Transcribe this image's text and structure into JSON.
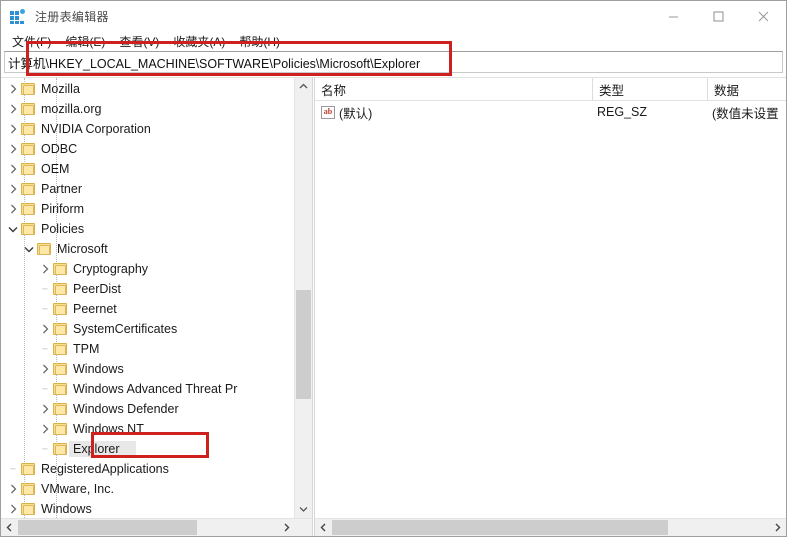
{
  "window": {
    "title": "注册表编辑器",
    "icon": "registry-editor-icon",
    "controls": {
      "minimize": "minimize-icon",
      "maximize": "maximize-icon",
      "close": "close-icon"
    }
  },
  "menubar": {
    "items": [
      {
        "label": "文件(F)",
        "name": "menu-file"
      },
      {
        "label": "编辑(E)",
        "name": "menu-edit"
      },
      {
        "label": "查看(V)",
        "name": "menu-view"
      },
      {
        "label": "收藏夹(A)",
        "name": "menu-favorites"
      },
      {
        "label": "帮助(H)",
        "name": "menu-help"
      }
    ]
  },
  "address_bar": {
    "value": "计算机\\HKEY_LOCAL_MACHINE\\SOFTWARE\\Policies\\Microsoft\\Explorer",
    "placeholder": ""
  },
  "tree": {
    "nodes": [
      {
        "label": "Mozilla",
        "depth": 2,
        "twist": "collapsed",
        "selected": false
      },
      {
        "label": "mozilla.org",
        "depth": 2,
        "twist": "collapsed",
        "selected": false
      },
      {
        "label": "NVIDIA Corporation",
        "depth": 2,
        "twist": "collapsed",
        "selected": false
      },
      {
        "label": "ODBC",
        "depth": 2,
        "twist": "collapsed",
        "selected": false
      },
      {
        "label": "OEM",
        "depth": 2,
        "twist": "collapsed",
        "selected": false
      },
      {
        "label": "Partner",
        "depth": 2,
        "twist": "collapsed",
        "selected": false
      },
      {
        "label": "Piriform",
        "depth": 2,
        "twist": "collapsed",
        "selected": false
      },
      {
        "label": "Policies",
        "depth": 2,
        "twist": "expanded",
        "selected": false
      },
      {
        "label": "Microsoft",
        "depth": 3,
        "twist": "expanded",
        "selected": false
      },
      {
        "label": "Cryptography",
        "depth": 4,
        "twist": "collapsed",
        "selected": false
      },
      {
        "label": "PeerDist",
        "depth": 4,
        "twist": "leaf",
        "selected": false
      },
      {
        "label": "Peernet",
        "depth": 4,
        "twist": "leaf",
        "selected": false
      },
      {
        "label": "SystemCertificates",
        "depth": 4,
        "twist": "collapsed",
        "selected": false
      },
      {
        "label": "TPM",
        "depth": 4,
        "twist": "leaf",
        "selected": false
      },
      {
        "label": "Windows",
        "depth": 4,
        "twist": "collapsed",
        "selected": false
      },
      {
        "label": "Windows Advanced Threat Pr",
        "depth": 4,
        "twist": "leaf",
        "selected": false
      },
      {
        "label": "Windows Defender",
        "depth": 4,
        "twist": "collapsed",
        "selected": false
      },
      {
        "label": "Windows NT",
        "depth": 4,
        "twist": "collapsed",
        "selected": false
      },
      {
        "label": "Explorer",
        "depth": 4,
        "twist": "leaf",
        "selected": true
      },
      {
        "label": "RegisteredApplications",
        "depth": 2,
        "twist": "leaf",
        "selected": false
      },
      {
        "label": "VMware, Inc.",
        "depth": 2,
        "twist": "collapsed",
        "selected": false
      },
      {
        "label": "Windows",
        "depth": 2,
        "twist": "collapsed",
        "selected": false
      }
    ],
    "scroll": {
      "vertical_thumb_top_pct": 48,
      "vertical_thumb_height_pct": 27,
      "horizontal_thumb_left_pct": 0,
      "horizontal_thumb_width_pct": 69
    }
  },
  "value_list": {
    "columns": [
      {
        "label": "名称",
        "name": "column-name"
      },
      {
        "label": "类型",
        "name": "column-type"
      },
      {
        "label": "数据",
        "name": "column-data"
      }
    ],
    "rows": [
      {
        "icon": "string-value-icon",
        "icon_text": "ab",
        "name": "(默认)",
        "type": "REG_SZ",
        "data": "(数值未设置"
      }
    ],
    "scroll": {
      "horizontal_thumb_left_pct": 0,
      "horizontal_thumb_width_pct": 77
    }
  },
  "annotations": {
    "address_box": {
      "color": "#cf2020",
      "target": "address-bar"
    },
    "explorer_box": {
      "color": "#cf2020",
      "target": "tree-node-explorer"
    }
  }
}
